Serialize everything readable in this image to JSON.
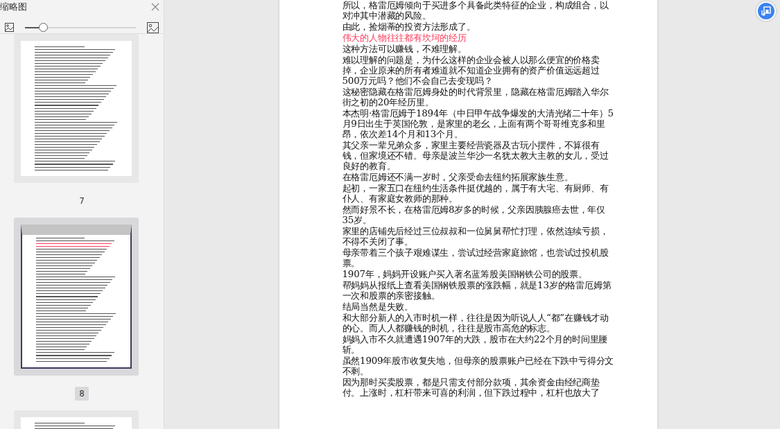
{
  "sidebar": {
    "title": "缩略图",
    "zoom_slider": {
      "level": 0.16
    },
    "thumbnails": [
      {
        "label": "7",
        "selected": false
      },
      {
        "label": "8",
        "selected": true
      },
      {
        "selected": false
      }
    ]
  },
  "document": {
    "paragraphs": [
      {
        "kind": "body",
        "text": "所以，格雷厄姆倾向于买进多个具备此类特征的企业，构成组合，以对冲其中潜藏的风险。"
      },
      {
        "kind": "body",
        "text": "由此，捡烟蒂的投资方法形成了。"
      },
      {
        "kind": "heading",
        "text": "伟大的人物往往都有坎坷的经历",
        "color": "#ff3b5c"
      },
      {
        "kind": "body",
        "text": "这种方法可以赚钱，不难理解。"
      },
      {
        "kind": "body",
        "text": "难以理解的问题是，为什么这样的企业会被人以那么便宜的价格卖掉，企业原来的所有者难道就不知道企业拥有的资产价值远远超过500万元吗？他们不会自己去变现吗？"
      },
      {
        "kind": "body",
        "text": "这秘密隐藏在格雷厄姆身处的时代背景里，隐藏在格雷厄姆踏入华尔街之初的20年经历里。"
      },
      {
        "kind": "body",
        "text": "本杰明·格雷厄姆于1894年（中日甲午战争爆发的大清光绪二十年）5月9日出生于英国伦敦，是家里的老幺，上面有两个哥哥维克多和里昂，依次差14个月和13个月。"
      },
      {
        "kind": "body",
        "text": "其父亲一辈兄弟众多，家里主要经营瓷器及古玩小摆件，不算很有钱，但家境还不错。母亲是波兰华沙一名犹太教大主教的女儿，受过良好的教育。"
      },
      {
        "kind": "body",
        "text": "在格雷厄姆还不满一岁时，父亲受命去纽约拓展家族生意。"
      },
      {
        "kind": "body",
        "text": "起初，一家五口在纽约生活条件挺优越的，属于有大宅、有厨师、有仆人、有家庭女教师的那种。"
      },
      {
        "kind": "body",
        "text": "然而好景不长，在格雷厄姆8岁多的时候，父亲因胰腺癌去世，年仅35岁。"
      },
      {
        "kind": "body",
        "text": "家里的店铺先后经过三位叔叔和一位舅舅帮忙打理，依然连续亏损，不得不关闭了事。"
      },
      {
        "kind": "body",
        "text": "母亲带着三个孩子艰难谋生，尝试过经营家庭旅馆，也尝试过投机股票。"
      },
      {
        "kind": "body",
        "text": "1907年，妈妈开设账户买入著名蓝筹股美国钢铁公司的股票。"
      },
      {
        "kind": "body",
        "text": "帮妈妈从报纸上查看美国钢铁股票的涨跌幅，就是13岁的格雷厄姆第一次和股票的亲密接触。"
      },
      {
        "kind": "body",
        "text": "结局当然是失败。"
      },
      {
        "kind": "body",
        "text": "和大部分新人的入市时机一样，往往是因为听说人人“都”在赚钱才动的心。而人人都赚钱的时机，往往是股市高危的标志。"
      },
      {
        "kind": "body",
        "text": "妈妈入市不久就遭遇1907年的大跌，股市在大约22个月的时间里腰斩。"
      },
      {
        "kind": "body",
        "text": "虽然1909年股市收复失地，但母亲的股票账户已经在下跌中亏得分文不剩。"
      },
      {
        "kind": "body",
        "text": "因为那时买卖股票，都是只需支付部分款项，其余资金由经纪商垫付。上涨时，杠杆带来可喜的利润，但下跌过程中，杠杆也放大了"
      }
    ]
  }
}
